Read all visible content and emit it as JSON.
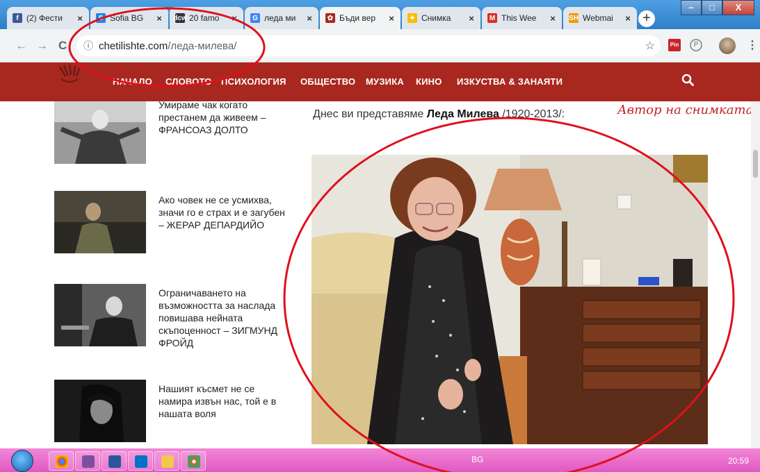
{
  "tabs": [
    {
      "label": "(2) Фести",
      "icon": "facebook-icon",
      "color": "#3b5998",
      "glyph": "f"
    },
    {
      "label": "Sofia BG",
      "icon": "sofia-icon",
      "color": "#1e88e5",
      "glyph": "S"
    },
    {
      "label": "20 famo",
      "icon": "dcw-icon",
      "color": "#333333",
      "glyph": "dcw"
    },
    {
      "label": "леда ми",
      "icon": "google-icon",
      "color": "#4285f4",
      "glyph": "G"
    },
    {
      "label": "Бъди вер",
      "icon": "site-logo-icon",
      "color": "#a8281f",
      "glyph": "✿",
      "active": true
    },
    {
      "label": "Снимка",
      "icon": "photos-icon",
      "color": "#fbbc05",
      "glyph": "✦"
    },
    {
      "label": "This Wee",
      "icon": "gmail-icon",
      "color": "#d93025",
      "glyph": "M"
    },
    {
      "label": "Webmai",
      "icon": "sh-icon",
      "color": "#f29900",
      "glyph": "SH"
    }
  ],
  "tab_close": "×",
  "new_tab": "+",
  "window": {
    "minimize": "–",
    "maximize": "□",
    "close": "X"
  },
  "address": {
    "url_host": "chetilishte.com",
    "url_path": "/леда-милева/",
    "back": "←",
    "forward": "→",
    "reload": "C",
    "info": "ⓘ",
    "star": "☆"
  },
  "extensions": {
    "pin": "Pin",
    "p": "P",
    "menu": "⋮"
  },
  "site_nav": {
    "items": [
      "НАЧАЛО",
      "СЛОВОТО",
      "ПСИХОЛОГИЯ",
      "ОБЩЕСТВО",
      "МУЗИКА",
      "КИНО",
      "ИЗКУСТВА & ЗАНАЯТИ"
    ]
  },
  "sidebar": [
    {
      "text": "Умираме чак когато престанем да живеем – ФРАНСОАЗ ДОЛТО"
    },
    {
      "text": "Ако човек не се усмихва, значи го е страх и е загубен – ЖЕРАР ДЕПАРДИЙО"
    },
    {
      "text": "Ограничаването на възможността за наслада повишава нейната скъпоценност – ЗИГМУНД ФРОЙД"
    },
    {
      "text": "Нашият късмет не се намира извън нас, той е в нашата воля"
    }
  ],
  "article": {
    "intro_prefix": "Днес ви представяме ",
    "intro_name": "Леда Милева",
    "intro_suffix": " /1920-2013/:",
    "author_question": "Автор на снимката?"
  },
  "taskbar": {
    "apps": [
      "chrome",
      "viber",
      "word",
      "outlook",
      "explorer",
      "paint"
    ],
    "tray_lang": "BG",
    "clock": "20:59"
  },
  "colors": {
    "nav": "#a8281f",
    "annotation": "#e0101a",
    "taskbar": "#e87ccf"
  }
}
